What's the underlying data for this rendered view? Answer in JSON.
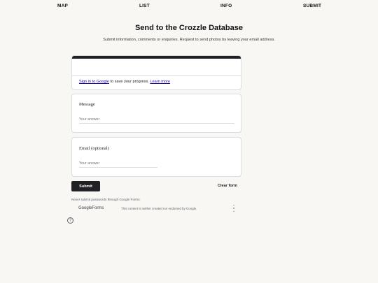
{
  "nav": {
    "map": "MAP",
    "list": "LIST",
    "info": "INFO",
    "submit": "SUBMIT"
  },
  "page": {
    "title": "Send to the Crozzle Database",
    "subtitle": "Submit information, comments or enquiries. Request to send photos by leaving your email address."
  },
  "form": {
    "signin_link": "Sign in to Google",
    "signin_text": " to save your progress. ",
    "learn_more": "Learn more",
    "message_label": "Message",
    "message_placeholder": "Your answer",
    "email_label": "Email (optional)",
    "email_placeholder": "Your answer",
    "submit_label": "Submit",
    "clear_label": "Clear form"
  },
  "footer": {
    "never_submit": "Never submit passwords through Google Forms.",
    "logo_google": "Google",
    "logo_forms": "Forms",
    "disclaimer": "This content is neither created nor endorsed by Google.",
    "help_glyph": "?",
    "colors": {
      "accent": "#202124",
      "link": "#1a0dab"
    }
  }
}
